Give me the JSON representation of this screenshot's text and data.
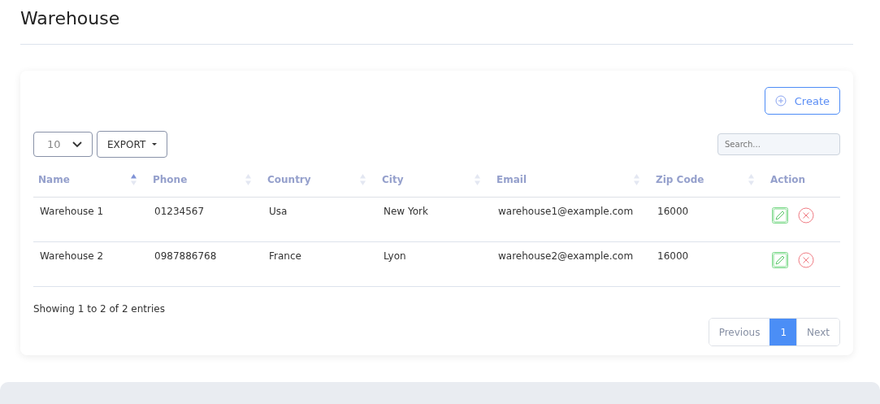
{
  "page": {
    "title": "Warehouse"
  },
  "toolbar": {
    "create_button": "Create",
    "page_size": "10",
    "export_button": "EXPORT",
    "search": {
      "placeholder": "Search..."
    }
  },
  "table": {
    "columns": [
      {
        "label": "Name",
        "sortable": true,
        "sorted": true
      },
      {
        "label": "Phone",
        "sortable": true,
        "sorted": false
      },
      {
        "label": "Country",
        "sortable": true,
        "sorted": false
      },
      {
        "label": "City",
        "sortable": true,
        "sorted": false
      },
      {
        "label": "Email",
        "sortable": true,
        "sorted": false
      },
      {
        "label": "Zip Code",
        "sortable": true,
        "sorted": false
      },
      {
        "label": "Action",
        "sortable": false
      }
    ],
    "rows": [
      {
        "cells": [
          "Warehouse 1",
          "01234567",
          "Usa",
          "New York",
          "warehouse1@example.com",
          "16000"
        ]
      },
      {
        "cells": [
          "Warehouse 2",
          "0987886768",
          "France",
          "Lyon",
          "warehouse2@example.com",
          "16000"
        ]
      }
    ]
  },
  "footer_info": "Showing 1 to 2 of 2 entries",
  "pagination": {
    "previous": "Previous",
    "pages": [
      {
        "label": "1",
        "selected": true
      }
    ],
    "next": "Next"
  }
}
